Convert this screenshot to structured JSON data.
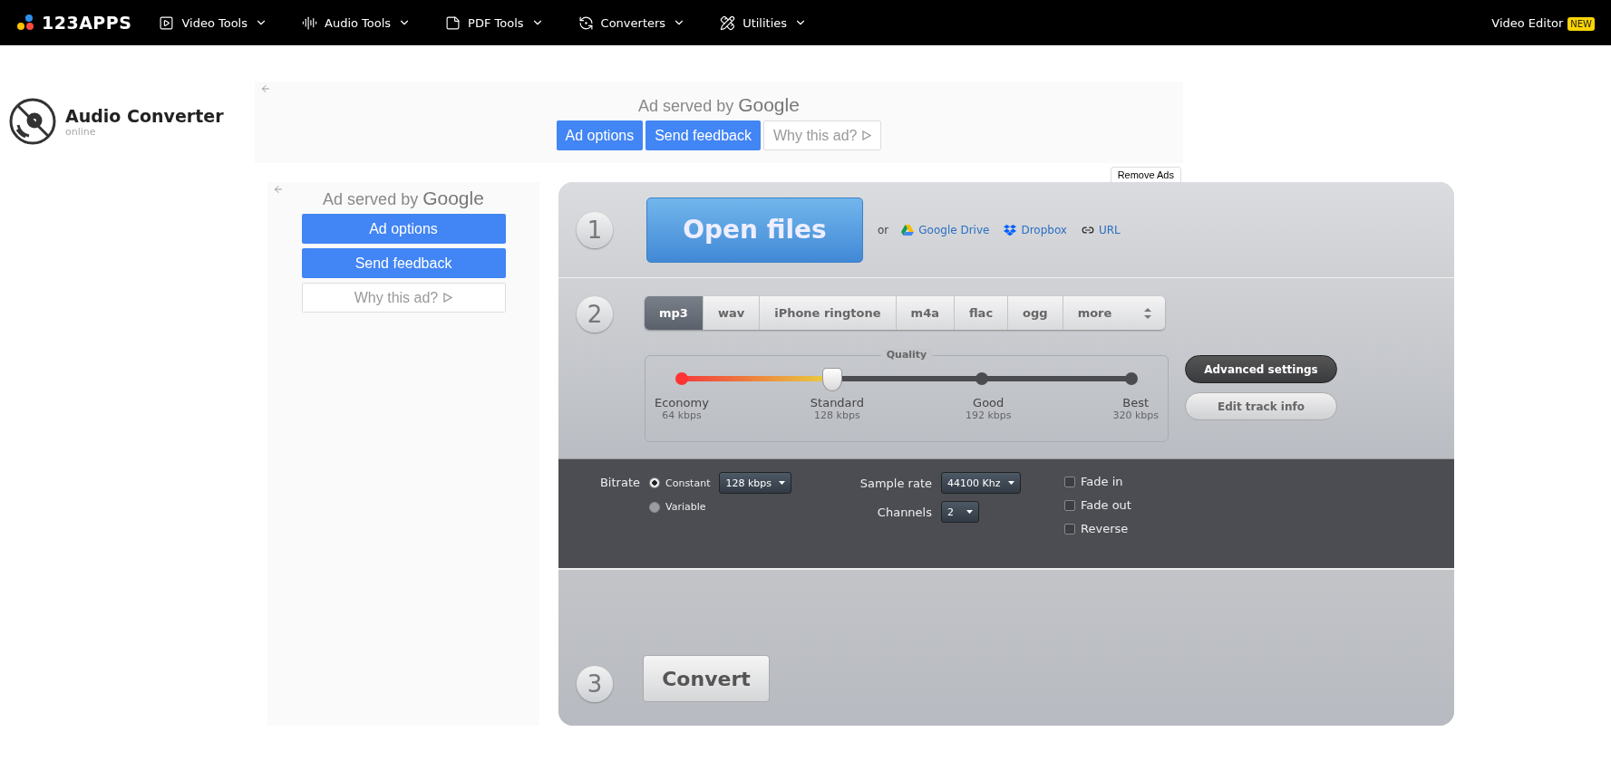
{
  "nav": {
    "logo": "123APPS",
    "items": [
      {
        "label": "Video Tools"
      },
      {
        "label": "Audio Tools"
      },
      {
        "label": "PDF Tools"
      },
      {
        "label": "Converters"
      },
      {
        "label": "Utilities"
      }
    ],
    "right": {
      "label": "Video Editor",
      "badge": "NEW"
    }
  },
  "app": {
    "title": "Audio Converter",
    "subtitle": "online"
  },
  "top_ad": {
    "label": "Ad served by",
    "brand": "Google",
    "buttons": [
      {
        "label": "Ad options",
        "kind": "primary"
      },
      {
        "label": "Send feedback",
        "kind": "primary"
      },
      {
        "label": "Why this ad?",
        "kind": "plain"
      }
    ]
  },
  "remove_ads": "Remove Ads",
  "side_ad": {
    "label": "Ad served by",
    "brand": "Google",
    "buttons": [
      {
        "label": "Ad options",
        "kind": "primary"
      },
      {
        "label": "Send feedback",
        "kind": "primary"
      },
      {
        "label": "Why this ad?",
        "kind": "plain"
      }
    ]
  },
  "step1": {
    "number": "1",
    "open": "Open files",
    "or": "or",
    "links": [
      {
        "label": "Google Drive",
        "kind": "drive"
      },
      {
        "label": "Dropbox",
        "kind": "dropbox"
      },
      {
        "label": "URL",
        "kind": "url"
      }
    ]
  },
  "step2": {
    "number": "2",
    "formats": [
      {
        "label": "mp3",
        "selected": true
      },
      {
        "label": "wav",
        "selected": false
      },
      {
        "label": "iPhone ringtone",
        "selected": false
      },
      {
        "label": "m4a",
        "selected": false
      },
      {
        "label": "flac",
        "selected": false
      },
      {
        "label": "ogg",
        "selected": false
      }
    ],
    "more": "more",
    "quality": {
      "legend": "Quality",
      "level": 0.333,
      "stops": [
        {
          "name": "Economy",
          "rate": "64 kbps"
        },
        {
          "name": "Standard",
          "rate": "128 kbps"
        },
        {
          "name": "Good",
          "rate": "192 kbps"
        },
        {
          "name": "Best",
          "rate": "320 kbps"
        }
      ]
    },
    "buttons": [
      {
        "label": "Advanced settings",
        "selected": true
      },
      {
        "label": "Edit track info",
        "selected": false
      }
    ]
  },
  "advanced": {
    "bitrate_label": "Bitrate",
    "modes": [
      {
        "label": "Constant",
        "selected": true
      },
      {
        "label": "Variable",
        "selected": false
      }
    ],
    "bitrate_value": "128 kbps",
    "sample_rate_label": "Sample rate",
    "sample_rate_value": "44100 Khz",
    "channels_label": "Channels",
    "channels_value": "2",
    "options": [
      {
        "label": "Fade in",
        "checked": false
      },
      {
        "label": "Fade out",
        "checked": false
      },
      {
        "label": "Reverse",
        "checked": false
      }
    ]
  },
  "step3": {
    "number": "3",
    "convert": "Convert"
  }
}
